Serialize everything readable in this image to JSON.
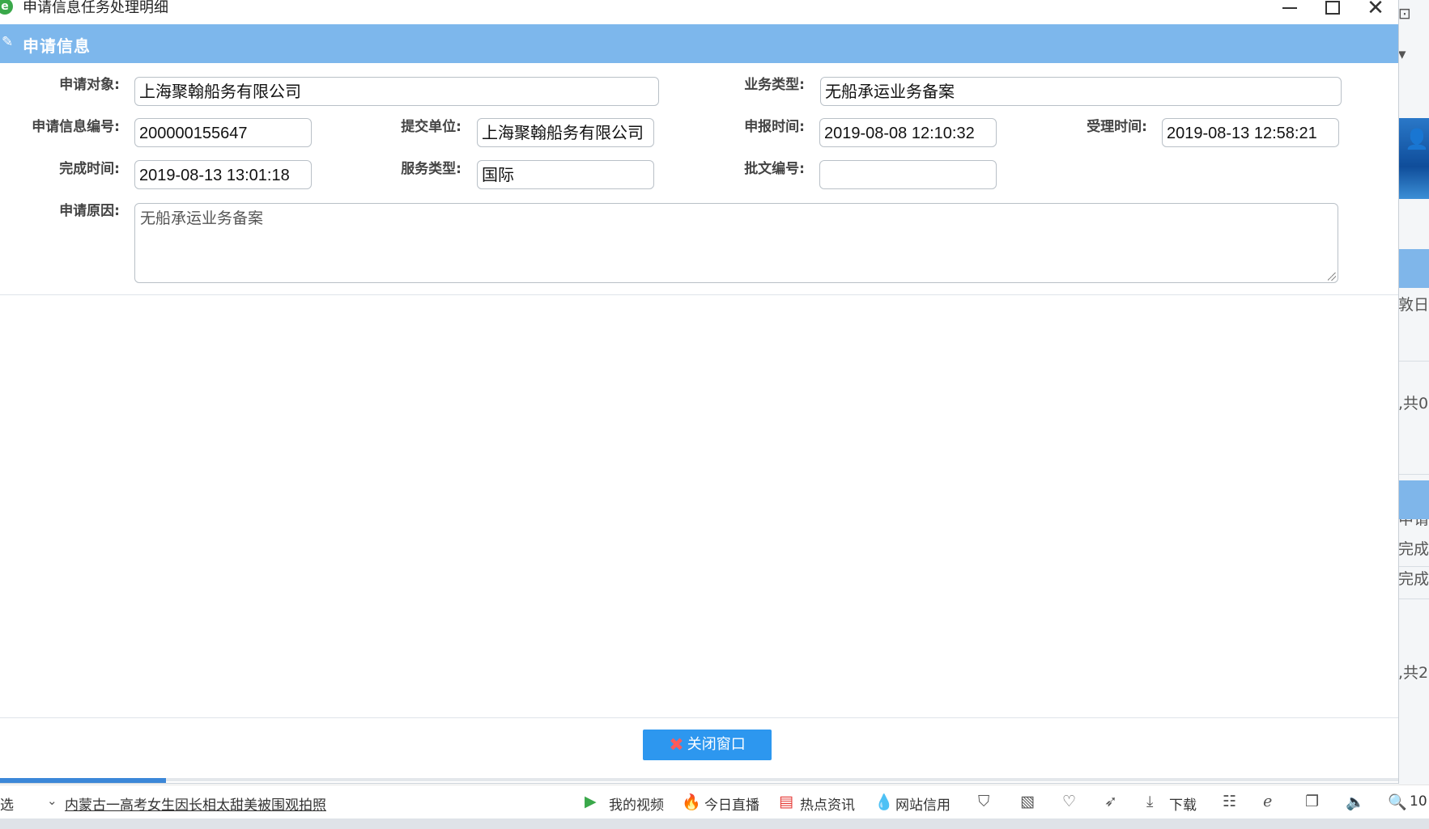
{
  "window": {
    "title": "申请信息任务处理明细",
    "app_icon": "e",
    "controls": {
      "minimize": "minimize-icon",
      "maximize": "maximize-icon",
      "close": "✕"
    }
  },
  "panel": {
    "title": "申请信息",
    "icon": "edit-icon"
  },
  "form": {
    "applicant_label": "申请对象:",
    "applicant_value": "上海聚翰船务有限公司",
    "business_type_label": "业务类型:",
    "business_type_value": "无船承运业务备案",
    "app_no_label": "申请信息编号:",
    "app_no_value": "200000155647",
    "submit_unit_label": "提交单位:",
    "submit_unit_value": "上海聚翰船务有限公司",
    "report_time_label": "申报时间:",
    "report_time_value": "2019-08-08 12:10:32",
    "accept_time_label": "受理时间:",
    "accept_time_value": "2019-08-13 12:58:21",
    "finish_time_label": "完成时间:",
    "finish_time_value": "2019-08-13 13:01:18",
    "service_type_label": "服务类型:",
    "service_type_value": "国际",
    "approval_no_label": "批文编号:",
    "approval_no_value": "",
    "reason_label": "申请原因:",
    "reason_value": "无船承运业务备案"
  },
  "footer": {
    "close_button": "关闭窗口"
  },
  "background_page": {
    "items": [
      "敦日",
      ",共0",
      "申请",
      "完成",
      "完成",
      ",共2"
    ]
  },
  "statusbar": {
    "left_cut": "选",
    "news": "内蒙古一高考女生因长相太甜美被围观拍照",
    "video": "我的视频",
    "live": "今日直播",
    "hot_news": "热点资讯",
    "credit": "网站信用",
    "download": "下载",
    "zoom": "10"
  },
  "colors": {
    "header": "#7db7ec",
    "button": "#2d97ef",
    "progress": "#3b87d8"
  }
}
